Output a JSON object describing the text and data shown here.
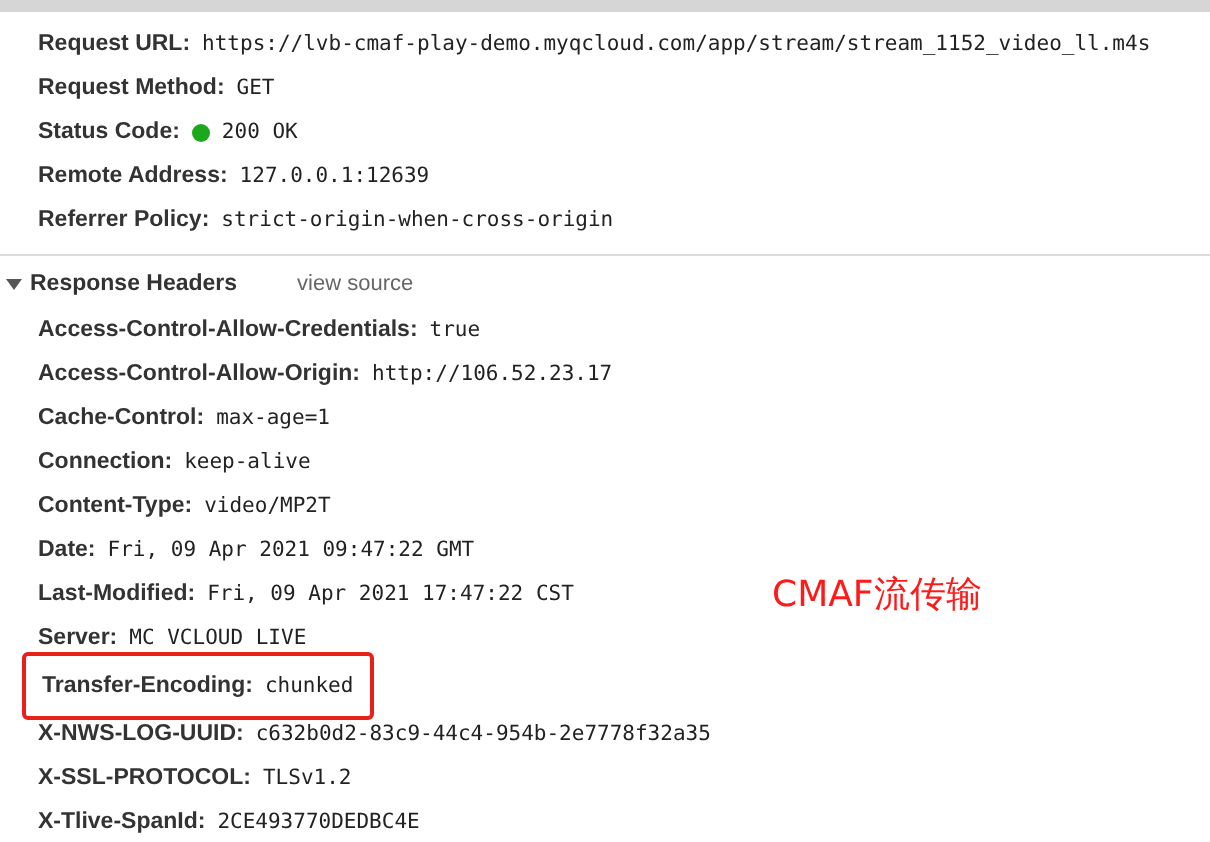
{
  "general": [
    {
      "name": "Request URL:",
      "value": "https://lvb-cmaf-play-demo.myqcloud.com/app/stream/stream_1152_video_ll.m4s"
    },
    {
      "name": "Request Method:",
      "value": "GET"
    },
    {
      "name": "Status Code:",
      "value": "200 OK",
      "color": "#1ca81c"
    },
    {
      "name": "Remote Address:",
      "value": "127.0.0.1:12639"
    },
    {
      "name": "Referrer Policy:",
      "value": "strict-origin-when-cross-origin"
    }
  ],
  "response_headers": {
    "title": "Response Headers",
    "expanded": true,
    "link": "view source",
    "headers": [
      {
        "name": "Access-Control-Allow-Credentials:",
        "value": "true",
        "highlighted": false
      },
      {
        "name": "Access-Control-Allow-Origin:",
        "value": "http://106.52.23.17",
        "highlighted": false
      },
      {
        "name": "Cache-Control:",
        "value": "max-age=1",
        "highlighted": false
      },
      {
        "name": "Connection:",
        "value": "keep-alive",
        "highlighted": false
      },
      {
        "name": "Content-Type:",
        "value": "video/MP2T",
        "highlighted": false
      },
      {
        "name": "Date:",
        "value": "Fri, 09 Apr 2021 09:47:22 GMT",
        "highlighted": false
      },
      {
        "name": "Last-Modified:",
        "value": "Fri, 09 Apr 2021 17:47:22 CST",
        "highlighted": false
      },
      {
        "name": "Server:",
        "value": "MC VCLOUD LIVE",
        "highlighted": false
      },
      {
        "name": "Transfer-Encoding:",
        "value": "chunked",
        "highlighted": true
      },
      {
        "name": "X-NWS-LOG-UUID:",
        "value": "c632b0d2-83c9-44c4-954b-2e7778f32a35",
        "highlighted": false
      },
      {
        "name": "X-SSL-PROTOCOL:",
        "value": "TLSv1.2",
        "highlighted": false
      },
      {
        "name": "X-Tlive-SpanId:",
        "value": "2CE493770DEDBC4E",
        "highlighted": false
      }
    ]
  },
  "annotation": "CMAF流传输"
}
